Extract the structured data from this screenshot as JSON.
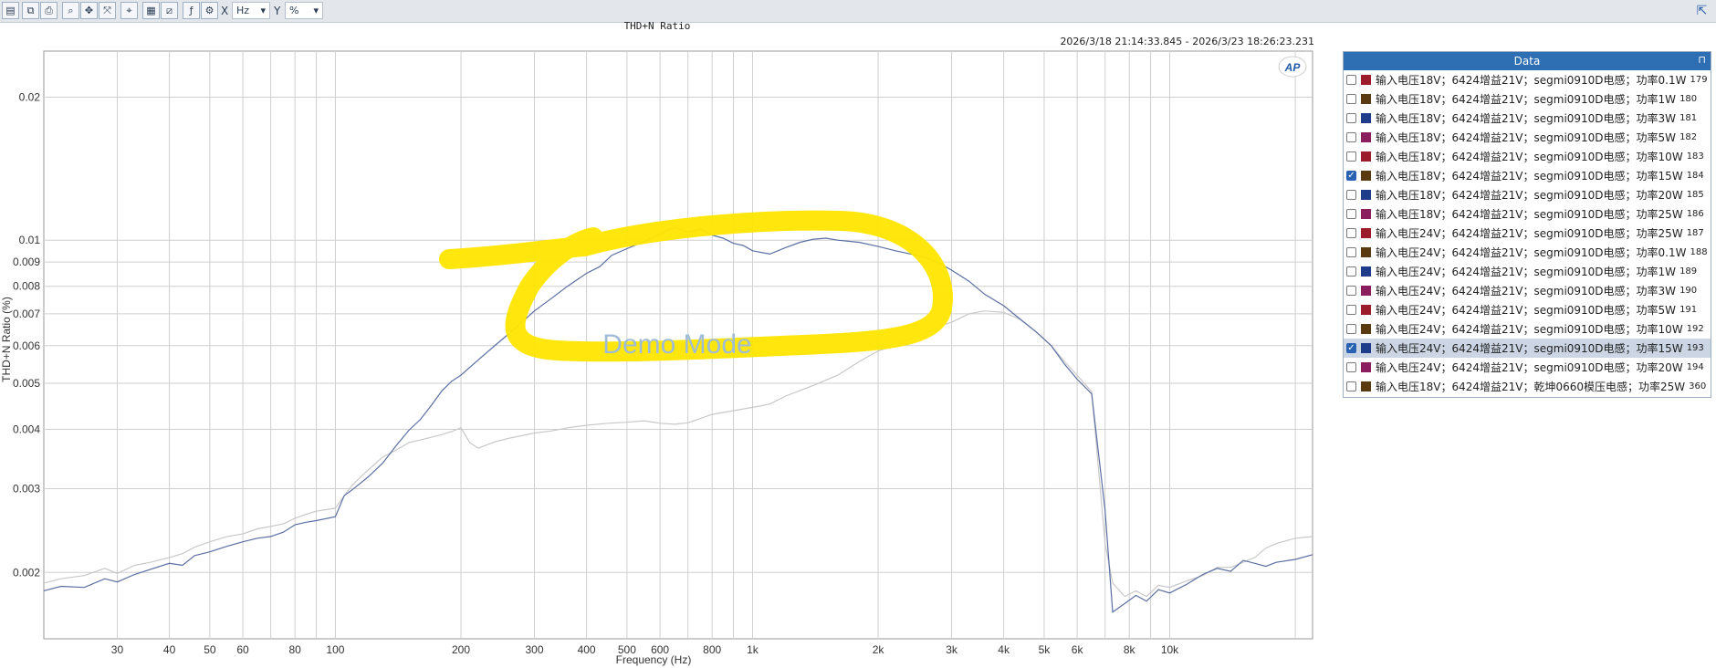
{
  "toolbar": {
    "x_label": "X",
    "x_unit": "Hz",
    "y_label": "Y",
    "y_unit": "%"
  },
  "chart_title": "THD+N Ratio",
  "date_range": "2026/3/18 21:14:33.845 - 2026/3/23 18:26:23.231",
  "watermark": "Demo Mode",
  "logo": "AP",
  "colors": {
    "series_dark": "#5a6fa3",
    "series_light": "#c8c8c8",
    "highlight": "#ffe600",
    "grid": "#cfcfcf",
    "panel_header": "#2e6fb4"
  },
  "data_panel": {
    "title": "Data",
    "rows": [
      {
        "label": "输入电压18V；6424增益21V；segmi0910D电感；功率0.1W",
        "id": "179",
        "color": "#9b1c2a",
        "checked": false
      },
      {
        "label": "输入电压18V；6424增益21V；segmi0910D电感；功率1W",
        "id": "180",
        "color": "#5a3a10",
        "checked": false
      },
      {
        "label": "输入电压18V；6424增益21V；segmi0910D电感；功率3W",
        "id": "181",
        "color": "#1e3c8a",
        "checked": false
      },
      {
        "label": "输入电压18V；6424增益21V；segmi0910D电感；功率5W",
        "id": "182",
        "color": "#8a1e5e",
        "checked": false
      },
      {
        "label": "输入电压18V；6424增益21V；segmi0910D电感；功率10W",
        "id": "183",
        "color": "#9b1c2a",
        "checked": false
      },
      {
        "label": "输入电压18V；6424增益21V；segmi0910D电感；功率15W",
        "id": "184",
        "color": "#5a3a10",
        "checked": true
      },
      {
        "label": "输入电压18V；6424增益21V；segmi0910D电感；功率20W",
        "id": "185",
        "color": "#1e3c8a",
        "checked": false
      },
      {
        "label": "输入电压18V；6424增益21V；segmi0910D电感；功率25W",
        "id": "186",
        "color": "#8a1e5e",
        "checked": false
      },
      {
        "label": "输入电压24V；6424增益21V；segmi0910D电感；功率25W",
        "id": "187",
        "color": "#9b1c2a",
        "checked": false
      },
      {
        "label": "输入电压24V；6424增益21V；segmi0910D电感；功率0.1W",
        "id": "188",
        "color": "#5a3a10",
        "checked": false
      },
      {
        "label": "输入电压24V；6424增益21V；segmi0910D电感；功率1W",
        "id": "189",
        "color": "#1e3c8a",
        "checked": false
      },
      {
        "label": "输入电压24V；6424增益21V；segmi0910D电感；功率3W",
        "id": "190",
        "color": "#8a1e5e",
        "checked": false
      },
      {
        "label": "输入电压24V；6424增益21V；segmi0910D电感；功率5W",
        "id": "191",
        "color": "#9b1c2a",
        "checked": false
      },
      {
        "label": "输入电压24V；6424增益21V；segmi0910D电感；功率10W",
        "id": "192",
        "color": "#5a3a10",
        "checked": false
      },
      {
        "label": "输入电压24V；6424增益21V；segmi0910D电感；功率15W",
        "id": "193",
        "color": "#1e3c8a",
        "checked": true,
        "selected": true
      },
      {
        "label": "输入电压24V；6424增益21V；segmi0910D电感；功率20W",
        "id": "194",
        "color": "#8a1e5e",
        "checked": false
      },
      {
        "label": "输入电压18V；6424增益21V；乾坤0660模压电感；功率25W",
        "id": "360",
        "color": "#5a3a10",
        "checked": false
      }
    ]
  },
  "chart_data": {
    "type": "line",
    "title": "THD+N Ratio",
    "xlabel": "Frequency (Hz)",
    "ylabel": "THD+N Ratio (%)",
    "x_scale": "log",
    "y_scale": "log",
    "xlim": [
      20,
      22000
    ],
    "ylim": [
      0.00145,
      0.025
    ],
    "grid": true,
    "x_ticks": [
      {
        "v": 30,
        "t": "30"
      },
      {
        "v": 40,
        "t": "40"
      },
      {
        "v": 50,
        "t": "50"
      },
      {
        "v": 60,
        "t": "60"
      },
      {
        "v": 80,
        "t": "80"
      },
      {
        "v": 100,
        "t": "100"
      },
      {
        "v": 200,
        "t": "200"
      },
      {
        "v": 300,
        "t": "300"
      },
      {
        "v": 400,
        "t": "400"
      },
      {
        "v": 500,
        "t": "500"
      },
      {
        "v": 600,
        "t": "600"
      },
      {
        "v": 800,
        "t": "800"
      },
      {
        "v": 1000,
        "t": "1k"
      },
      {
        "v": 2000,
        "t": "2k"
      },
      {
        "v": 3000,
        "t": "3k"
      },
      {
        "v": 4000,
        "t": "4k"
      },
      {
        "v": 5000,
        "t": "5k"
      },
      {
        "v": 6000,
        "t": "6k"
      },
      {
        "v": 8000,
        "t": "8k"
      },
      {
        "v": 10000,
        "t": "10k"
      }
    ],
    "x_minor": [
      70,
      90,
      700,
      900,
      7000,
      9000,
      20000
    ],
    "y_ticks": [
      {
        "v": 0.002,
        "t": "0.002"
      },
      {
        "v": 0.003,
        "t": "0.003"
      },
      {
        "v": 0.004,
        "t": "0.004"
      },
      {
        "v": 0.005,
        "t": "0.005"
      },
      {
        "v": 0.006,
        "t": "0.006"
      },
      {
        "v": 0.007,
        "t": "0.007"
      },
      {
        "v": 0.008,
        "t": "0.008"
      },
      {
        "v": 0.009,
        "t": "0.009"
      },
      {
        "v": 0.01,
        "t": "0.01"
      },
      {
        "v": 0.02,
        "t": "0.02"
      }
    ],
    "series": [
      {
        "color": "#5a6fa3",
        "points": [
          [
            20,
            0.00183
          ],
          [
            22,
            0.00187
          ],
          [
            25,
            0.00186
          ],
          [
            28,
            0.00194
          ],
          [
            30,
            0.00191
          ],
          [
            33,
            0.00198
          ],
          [
            36,
            0.00203
          ],
          [
            40,
            0.00209
          ],
          [
            43,
            0.00207
          ],
          [
            46,
            0.00217
          ],
          [
            50,
            0.00221
          ],
          [
            55,
            0.00227
          ],
          [
            60,
            0.00232
          ],
          [
            65,
            0.00236
          ],
          [
            70,
            0.00238
          ],
          [
            75,
            0.00243
          ],
          [
            80,
            0.00252
          ],
          [
            85,
            0.00255
          ],
          [
            90,
            0.00257
          ],
          [
            100,
            0.00262
          ],
          [
            105,
            0.0029
          ],
          [
            110,
            0.00299
          ],
          [
            120,
            0.00318
          ],
          [
            130,
            0.0034
          ],
          [
            140,
            0.0037
          ],
          [
            150,
            0.00398
          ],
          [
            160,
            0.0042
          ],
          [
            170,
            0.0045
          ],
          [
            180,
            0.00482
          ],
          [
            190,
            0.00505
          ],
          [
            200,
            0.0052
          ],
          [
            220,
            0.0056
          ],
          [
            240,
            0.00598
          ],
          [
            260,
            0.00635
          ],
          [
            280,
            0.00672
          ],
          [
            300,
            0.0071
          ],
          [
            330,
            0.00755
          ],
          [
            360,
            0.008
          ],
          [
            400,
            0.00852
          ],
          [
            430,
            0.0088
          ],
          [
            460,
            0.0093
          ],
          [
            500,
            0.0096
          ],
          [
            550,
            0.00995
          ],
          [
            600,
            0.0103
          ],
          [
            650,
            0.01065
          ],
          [
            700,
            0.0104
          ],
          [
            750,
            0.01055
          ],
          [
            800,
            0.01025
          ],
          [
            850,
            0.0101
          ],
          [
            900,
            0.00985
          ],
          [
            950,
            0.00975
          ],
          [
            1000,
            0.0095
          ],
          [
            1100,
            0.00935
          ],
          [
            1200,
            0.00965
          ],
          [
            1300,
            0.0099
          ],
          [
            1400,
            0.01005
          ],
          [
            1500,
            0.0101
          ],
          [
            1600,
            0.01
          ],
          [
            1800,
            0.0099
          ],
          [
            2000,
            0.0097
          ],
          [
            2200,
            0.0095
          ],
          [
            2400,
            0.00935
          ],
          [
            2600,
            0.0092
          ],
          [
            2800,
            0.00895
          ],
          [
            3000,
            0.00865
          ],
          [
            3300,
            0.0082
          ],
          [
            3600,
            0.0077
          ],
          [
            4000,
            0.00728
          ],
          [
            4400,
            0.0068
          ],
          [
            4800,
            0.0064
          ],
          [
            5200,
            0.006
          ],
          [
            5600,
            0.00548
          ],
          [
            6000,
            0.0051
          ],
          [
            6500,
            0.00475
          ],
          [
            7000,
            0.0027
          ],
          [
            7300,
            0.00165
          ],
          [
            7800,
            0.00172
          ],
          [
            8300,
            0.00179
          ],
          [
            8800,
            0.00174
          ],
          [
            9400,
            0.00184
          ],
          [
            10000,
            0.00181
          ],
          [
            11000,
            0.00189
          ],
          [
            12000,
            0.00198
          ],
          [
            13000,
            0.00204
          ],
          [
            14000,
            0.00201
          ],
          [
            15000,
            0.00212
          ],
          [
            16000,
            0.00209
          ],
          [
            17000,
            0.00206
          ],
          [
            18000,
            0.0021
          ],
          [
            20000,
            0.00213
          ],
          [
            22000,
            0.00218
          ]
        ]
      },
      {
        "color": "#c8c8c8",
        "points": [
          [
            20,
            0.0019
          ],
          [
            22,
            0.00194
          ],
          [
            25,
            0.00197
          ],
          [
            28,
            0.00204
          ],
          [
            30,
            0.00199
          ],
          [
            33,
            0.00207
          ],
          [
            36,
            0.0021
          ],
          [
            40,
            0.00215
          ],
          [
            43,
            0.00219
          ],
          [
            46,
            0.00226
          ],
          [
            50,
            0.00232
          ],
          [
            55,
            0.00238
          ],
          [
            60,
            0.00241
          ],
          [
            65,
            0.00247
          ],
          [
            70,
            0.0025
          ],
          [
            75,
            0.00253
          ],
          [
            80,
            0.0026
          ],
          [
            85,
            0.00265
          ],
          [
            90,
            0.00269
          ],
          [
            100,
            0.00273
          ],
          [
            105,
            0.0029
          ],
          [
            110,
            0.00306
          ],
          [
            120,
            0.00329
          ],
          [
            130,
            0.0035
          ],
          [
            140,
            0.00362
          ],
          [
            150,
            0.00375
          ],
          [
            160,
            0.0038
          ],
          [
            170,
            0.00385
          ],
          [
            180,
            0.0039
          ],
          [
            190,
            0.00396
          ],
          [
            200,
            0.00403
          ],
          [
            210,
            0.00375
          ],
          [
            220,
            0.00365
          ],
          [
            240,
            0.00376
          ],
          [
            260,
            0.00383
          ],
          [
            280,
            0.00388
          ],
          [
            300,
            0.00393
          ],
          [
            330,
            0.00397
          ],
          [
            360,
            0.00403
          ],
          [
            400,
            0.00408
          ],
          [
            450,
            0.00412
          ],
          [
            500,
            0.00414
          ],
          [
            550,
            0.00417
          ],
          [
            600,
            0.00412
          ],
          [
            650,
            0.0041
          ],
          [
            700,
            0.00413
          ],
          [
            800,
            0.0043
          ],
          [
            900,
            0.00438
          ],
          [
            1000,
            0.00445
          ],
          [
            1100,
            0.00452
          ],
          [
            1200,
            0.0047
          ],
          [
            1400,
            0.00495
          ],
          [
            1600,
            0.0052
          ],
          [
            1800,
            0.00555
          ],
          [
            2000,
            0.00585
          ],
          [
            2200,
            0.006
          ],
          [
            2400,
            0.0062
          ],
          [
            2600,
            0.0064
          ],
          [
            2800,
            0.0066
          ],
          [
            3000,
            0.00672
          ],
          [
            3300,
            0.007
          ],
          [
            3600,
            0.0071
          ],
          [
            4000,
            0.00705
          ],
          [
            4400,
            0.0068
          ],
          [
            4800,
            0.0064
          ],
          [
            5200,
            0.006
          ],
          [
            5600,
            0.00555
          ],
          [
            6000,
            0.0052
          ],
          [
            6500,
            0.0048
          ],
          [
            7000,
            0.0023
          ],
          [
            7300,
            0.0019
          ],
          [
            7800,
            0.00178
          ],
          [
            8300,
            0.00183
          ],
          [
            8800,
            0.00178
          ],
          [
            9400,
            0.00188
          ],
          [
            10000,
            0.00186
          ],
          [
            11000,
            0.00192
          ],
          [
            12000,
            0.00197
          ],
          [
            13000,
            0.00205
          ],
          [
            14000,
            0.00205
          ],
          [
            15000,
            0.0021
          ],
          [
            16000,
            0.00215
          ],
          [
            17000,
            0.00225
          ],
          [
            18000,
            0.0023
          ],
          [
            20000,
            0.00236
          ],
          [
            22000,
            0.00238
          ]
        ]
      }
    ]
  }
}
